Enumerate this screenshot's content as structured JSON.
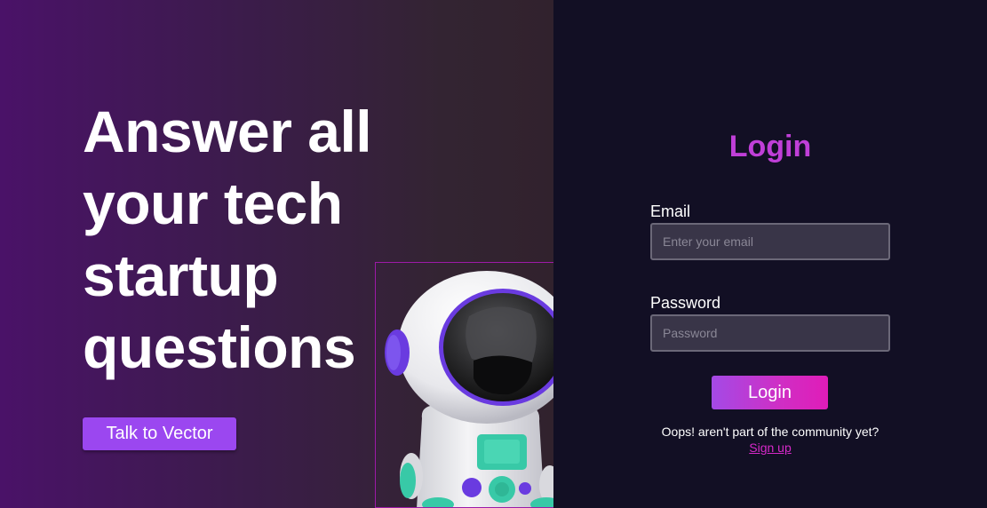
{
  "hero": {
    "headline_lines": [
      "Answer all",
      "your tech",
      "startup",
      "questions"
    ],
    "cta_label": "Talk to Vector",
    "illustration": "astronaut-robot"
  },
  "login": {
    "title": "Login",
    "email_label": "Email",
    "email_placeholder": "Enter your email",
    "password_label": "Password",
    "password_placeholder": "Password",
    "submit_label": "Login",
    "signup_prompt": "Oops! aren't part of the community yet?",
    "signup_link": "Sign up"
  },
  "colors": {
    "accent_purple": "#9b47f0",
    "title_magenta": "#c03fd8",
    "link_pink": "#d629c8",
    "panel_bg": "#120f24"
  }
}
